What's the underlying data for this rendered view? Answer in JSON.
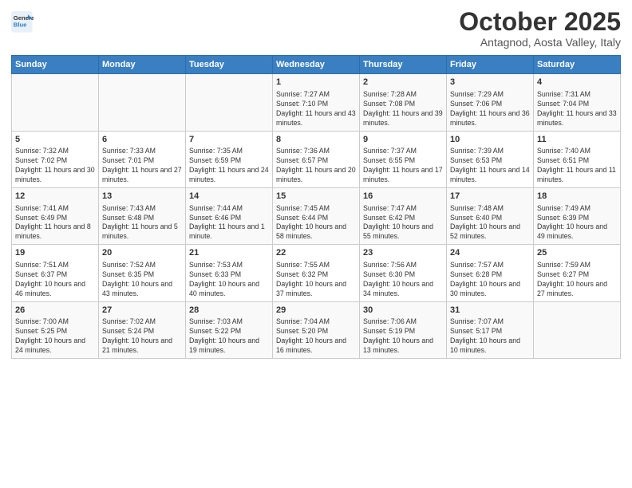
{
  "header": {
    "logo_line1": "General",
    "logo_line2": "Blue",
    "month": "October 2025",
    "location": "Antagnod, Aosta Valley, Italy"
  },
  "weekdays": [
    "Sunday",
    "Monday",
    "Tuesday",
    "Wednesday",
    "Thursday",
    "Friday",
    "Saturday"
  ],
  "weeks": [
    [
      {
        "day": "",
        "info": ""
      },
      {
        "day": "",
        "info": ""
      },
      {
        "day": "",
        "info": ""
      },
      {
        "day": "1",
        "info": "Sunrise: 7:27 AM\nSunset: 7:10 PM\nDaylight: 11 hours and 43 minutes."
      },
      {
        "day": "2",
        "info": "Sunrise: 7:28 AM\nSunset: 7:08 PM\nDaylight: 11 hours and 39 minutes."
      },
      {
        "day": "3",
        "info": "Sunrise: 7:29 AM\nSunset: 7:06 PM\nDaylight: 11 hours and 36 minutes."
      },
      {
        "day": "4",
        "info": "Sunrise: 7:31 AM\nSunset: 7:04 PM\nDaylight: 11 hours and 33 minutes."
      }
    ],
    [
      {
        "day": "5",
        "info": "Sunrise: 7:32 AM\nSunset: 7:02 PM\nDaylight: 11 hours and 30 minutes."
      },
      {
        "day": "6",
        "info": "Sunrise: 7:33 AM\nSunset: 7:01 PM\nDaylight: 11 hours and 27 minutes."
      },
      {
        "day": "7",
        "info": "Sunrise: 7:35 AM\nSunset: 6:59 PM\nDaylight: 11 hours and 24 minutes."
      },
      {
        "day": "8",
        "info": "Sunrise: 7:36 AM\nSunset: 6:57 PM\nDaylight: 11 hours and 20 minutes."
      },
      {
        "day": "9",
        "info": "Sunrise: 7:37 AM\nSunset: 6:55 PM\nDaylight: 11 hours and 17 minutes."
      },
      {
        "day": "10",
        "info": "Sunrise: 7:39 AM\nSunset: 6:53 PM\nDaylight: 11 hours and 14 minutes."
      },
      {
        "day": "11",
        "info": "Sunrise: 7:40 AM\nSunset: 6:51 PM\nDaylight: 11 hours and 11 minutes."
      }
    ],
    [
      {
        "day": "12",
        "info": "Sunrise: 7:41 AM\nSunset: 6:49 PM\nDaylight: 11 hours and 8 minutes."
      },
      {
        "day": "13",
        "info": "Sunrise: 7:43 AM\nSunset: 6:48 PM\nDaylight: 11 hours and 5 minutes."
      },
      {
        "day": "14",
        "info": "Sunrise: 7:44 AM\nSunset: 6:46 PM\nDaylight: 11 hours and 1 minute."
      },
      {
        "day": "15",
        "info": "Sunrise: 7:45 AM\nSunset: 6:44 PM\nDaylight: 10 hours and 58 minutes."
      },
      {
        "day": "16",
        "info": "Sunrise: 7:47 AM\nSunset: 6:42 PM\nDaylight: 10 hours and 55 minutes."
      },
      {
        "day": "17",
        "info": "Sunrise: 7:48 AM\nSunset: 6:40 PM\nDaylight: 10 hours and 52 minutes."
      },
      {
        "day": "18",
        "info": "Sunrise: 7:49 AM\nSunset: 6:39 PM\nDaylight: 10 hours and 49 minutes."
      }
    ],
    [
      {
        "day": "19",
        "info": "Sunrise: 7:51 AM\nSunset: 6:37 PM\nDaylight: 10 hours and 46 minutes."
      },
      {
        "day": "20",
        "info": "Sunrise: 7:52 AM\nSunset: 6:35 PM\nDaylight: 10 hours and 43 minutes."
      },
      {
        "day": "21",
        "info": "Sunrise: 7:53 AM\nSunset: 6:33 PM\nDaylight: 10 hours and 40 minutes."
      },
      {
        "day": "22",
        "info": "Sunrise: 7:55 AM\nSunset: 6:32 PM\nDaylight: 10 hours and 37 minutes."
      },
      {
        "day": "23",
        "info": "Sunrise: 7:56 AM\nSunset: 6:30 PM\nDaylight: 10 hours and 34 minutes."
      },
      {
        "day": "24",
        "info": "Sunrise: 7:57 AM\nSunset: 6:28 PM\nDaylight: 10 hours and 30 minutes."
      },
      {
        "day": "25",
        "info": "Sunrise: 7:59 AM\nSunset: 6:27 PM\nDaylight: 10 hours and 27 minutes."
      }
    ],
    [
      {
        "day": "26",
        "info": "Sunrise: 7:00 AM\nSunset: 5:25 PM\nDaylight: 10 hours and 24 minutes."
      },
      {
        "day": "27",
        "info": "Sunrise: 7:02 AM\nSunset: 5:24 PM\nDaylight: 10 hours and 21 minutes."
      },
      {
        "day": "28",
        "info": "Sunrise: 7:03 AM\nSunset: 5:22 PM\nDaylight: 10 hours and 19 minutes."
      },
      {
        "day": "29",
        "info": "Sunrise: 7:04 AM\nSunset: 5:20 PM\nDaylight: 10 hours and 16 minutes."
      },
      {
        "day": "30",
        "info": "Sunrise: 7:06 AM\nSunset: 5:19 PM\nDaylight: 10 hours and 13 minutes."
      },
      {
        "day": "31",
        "info": "Sunrise: 7:07 AM\nSunset: 5:17 PM\nDaylight: 10 hours and 10 minutes."
      },
      {
        "day": "",
        "info": ""
      }
    ]
  ]
}
